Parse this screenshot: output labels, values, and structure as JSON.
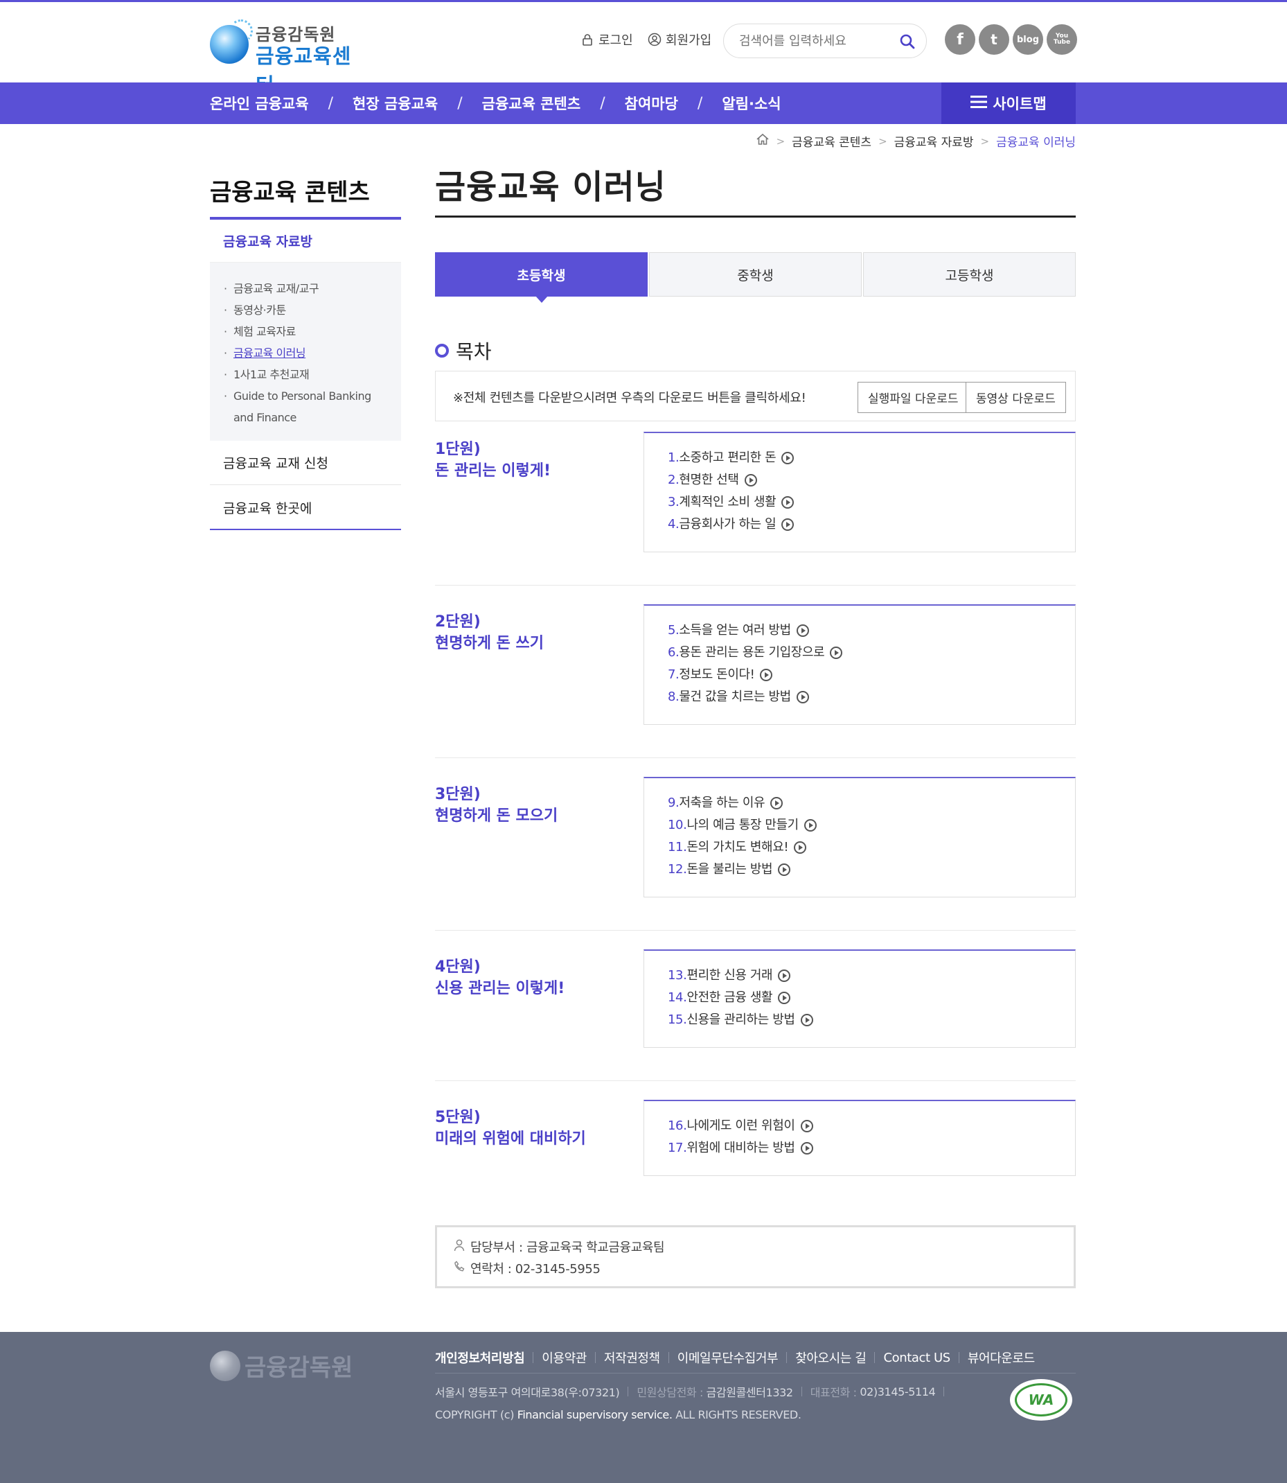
{
  "header": {
    "logo": {
      "line1": "금융감독원",
      "line2": "금융교육센터"
    },
    "login": "로그인",
    "join": "회원가입",
    "search_placeholder": "검색어를 입력하세요",
    "sns": [
      "f",
      "t",
      "blog",
      "You Tube"
    ]
  },
  "gnb": {
    "items": [
      "온라인 금융교육",
      "현장 금융교육",
      "금융교육 콘텐츠",
      "참여마당",
      "알림·소식"
    ],
    "sitemap": "사이트맵"
  },
  "breadcrumb": [
    "금융교육 콘텐츠",
    "금융교육 자료방",
    "금융교육 이러닝"
  ],
  "lnb": {
    "title": "금융교육 콘텐츠",
    "active_group": "금융교육 자료방",
    "sub_items": [
      "금융교육 교재/교구",
      "동영상·카툰",
      "체험 교육자료",
      "금융교육 이러닝",
      "1사1교 추천교재",
      "Guide to Personal Banking and Finance"
    ],
    "other_items": [
      "금융교육 교재 신청",
      "금융교육 한곳에"
    ]
  },
  "page": {
    "title": "금융교육 이러닝",
    "tabs": [
      "초등학생",
      "중학생",
      "고등학생"
    ],
    "toc_heading": "목차",
    "notice": "※전체 컨텐츠를 다운받으시려면 우측의 다운로드 버튼을 클릭하세요!",
    "btn_exec": "실행파일 다운로드",
    "btn_video": "동영상 다운로드"
  },
  "units": [
    {
      "label": "1단원)",
      "title": "돈 관리는 이렇게!",
      "lessons": [
        {
          "num": "1.",
          "text": "소중하고 편리한 돈"
        },
        {
          "num": "2.",
          "text": "현명한 선택"
        },
        {
          "num": "3.",
          "text": "계획적인 소비 생활"
        },
        {
          "num": "4.",
          "text": "금융회사가 하는 일"
        }
      ]
    },
    {
      "label": "2단원)",
      "title": "현명하게 돈 쓰기",
      "lessons": [
        {
          "num": "5.",
          "text": "소득을 얻는 여러 방법"
        },
        {
          "num": "6.",
          "text": "용돈 관리는 용돈 기입장으로"
        },
        {
          "num": "7.",
          "text": "정보도 돈이다!"
        },
        {
          "num": "8.",
          "text": "물건 값을 치르는 방법"
        }
      ]
    },
    {
      "label": "3단원)",
      "title": "현명하게 돈 모으기",
      "lessons": [
        {
          "num": "9.",
          "text": "저축을 하는 이유"
        },
        {
          "num": "10.",
          "text": "나의 예금 통장 만들기"
        },
        {
          "num": "11.",
          "text": "돈의 가치도 변해요!"
        },
        {
          "num": "12.",
          "text": "돈을 불리는 방법"
        }
      ]
    },
    {
      "label": "4단원)",
      "title": "신용 관리는 이렇게!",
      "lessons": [
        {
          "num": "13.",
          "text": "편리한 신용 거래"
        },
        {
          "num": "14.",
          "text": "안전한 금융 생활"
        },
        {
          "num": "15.",
          "text": "신용을 관리하는 방법"
        }
      ]
    },
    {
      "label": "5단원)",
      "title": "미래의 위험에 대비하기",
      "lessons": [
        {
          "num": "16.",
          "text": "나에게도 이런 위험이"
        },
        {
          "num": "17.",
          "text": "위험에 대비하는 방법"
        }
      ]
    }
  ],
  "contact": {
    "dept": "담당부서 : 금융교육국 학교금융교육팀",
    "phone": "연락처 : 02-3145-5955"
  },
  "footer": {
    "logo": "금융감독원",
    "links": [
      "개인정보처리방침",
      "이용약관",
      "저작권정책",
      "이메일무단수집거부",
      "찾아오시는 길",
      "Contact US",
      "뷰어다운로드"
    ],
    "address": "서울시 영등포구 여의대로38(우:07321)",
    "call_label": "민원상담전화 :",
    "call_value": "금감원콜센터1332",
    "rep_label": "대표전화 :",
    "rep_value": "02)3145-5114",
    "copyright_pre": "COPYRIGHT (c)",
    "copyright_org": "Financial supervisory service.",
    "copyright_post": "ALL RIGHTS RESERVED.",
    "wa_mark": "WA"
  },
  "colors": {
    "accent": "#5a50d6",
    "accent_dark": "#4338c4",
    "footer_bg": "#646c7f"
  }
}
